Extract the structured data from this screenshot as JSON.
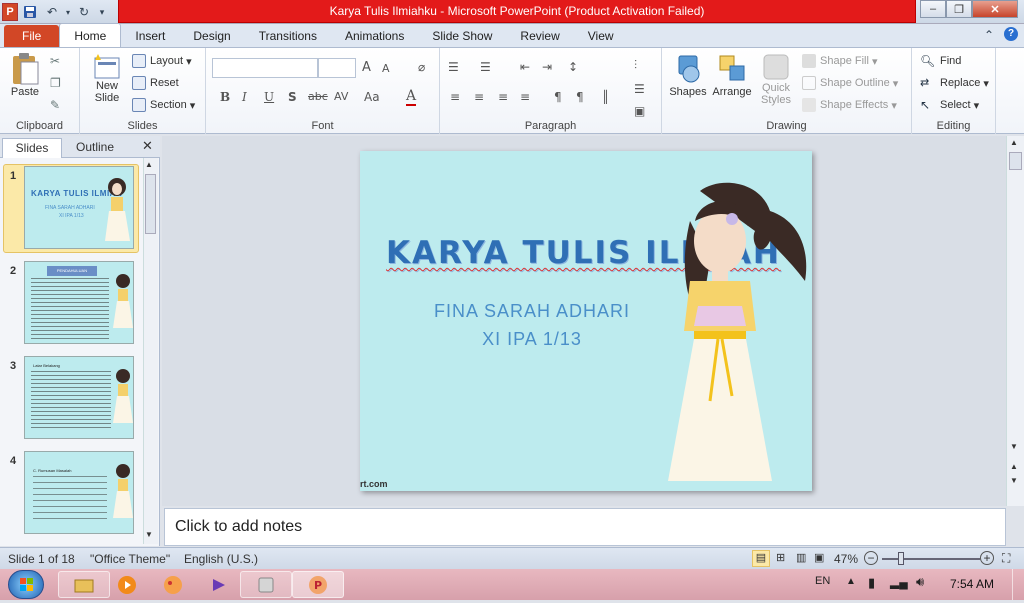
{
  "window": {
    "title": "Karya Tulis Ilmiahku  -  Microsoft PowerPoint (Product Activation Failed)",
    "app_icon": "P"
  },
  "tabs": [
    "File",
    "Home",
    "Insert",
    "Design",
    "Transitions",
    "Animations",
    "Slide Show",
    "Review",
    "View"
  ],
  "active_tab": "Home",
  "ribbon": {
    "clipboard": {
      "paste": "Paste",
      "label": "Clipboard"
    },
    "slides": {
      "new_slide_1": "New",
      "new_slide_2": "Slide",
      "layout": "Layout",
      "reset": "Reset",
      "section": "Section",
      "label": "Slides"
    },
    "font": {
      "label": "Font",
      "font_name": "",
      "font_size": "",
      "bold": "B",
      "italic": "I",
      "underline": "U",
      "shadow": "S",
      "strike": "abc",
      "spacing": "AV",
      "case": "Aa",
      "color": "A",
      "grow": "A",
      "shrink": "A"
    },
    "paragraph": {
      "label": "Paragraph"
    },
    "drawing": {
      "shapes": "Shapes",
      "arrange": "Arrange",
      "quick_styles_1": "Quick",
      "quick_styles_2": "Styles",
      "shape_fill": "Shape Fill",
      "shape_outline": "Shape Outline",
      "shape_effects": "Shape Effects",
      "label": "Drawing"
    },
    "editing": {
      "find": "Find",
      "replace": "Replace",
      "select": "Select",
      "label": "Editing"
    }
  },
  "left_pane": {
    "tab_slides": "Slides",
    "tab_outline": "Outline",
    "thumbnails": [
      {
        "num": "1",
        "title": "KARYA TULIS ILMIAH",
        "line1": "FINA SARAH ADHARI",
        "line2": "XI IPA 1/13"
      },
      {
        "num": "2",
        "title": "PENDAHULUAN"
      },
      {
        "num": "3",
        "title": "Latar Belakang"
      },
      {
        "num": "4",
        "title": "C. Rumusan Masalah"
      }
    ]
  },
  "slide": {
    "title": "KARYA TULIS ILMIAH",
    "subtitle_1": "FINA SARAH ADHARI",
    "subtitle_2": "XI IPA 1/13",
    "watermark": "rt.com",
    "colors": {
      "background": "#bdebee",
      "title": "#2f6fb5",
      "subtitle": "#4a8fc9"
    }
  },
  "notes_placeholder": "Click to add notes",
  "status": {
    "slide_info": "Slide 1 of 18",
    "theme": "\"Office Theme\"",
    "language": "English (U.S.)",
    "zoom": "47%"
  },
  "taskbar": {
    "lang": "EN",
    "time": "7:54 AM"
  }
}
